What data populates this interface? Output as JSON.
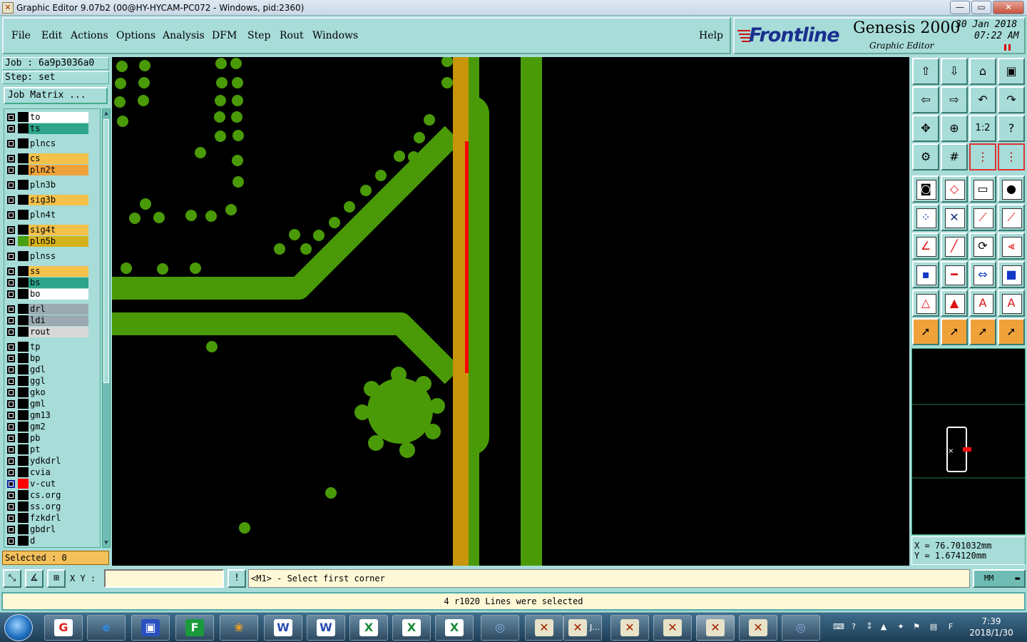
{
  "window": {
    "title": "Graphic Editor 9.07b2 (00@HY-HYCAM-PC072 - Windows, pid:2360)",
    "buttons": [
      "—",
      "▭",
      "✕"
    ]
  },
  "menu": {
    "items": [
      "File",
      "Edit",
      "Actions",
      "Options",
      "Analysis",
      "DFM",
      "Step",
      "Rout",
      "Windows"
    ],
    "help": "Help"
  },
  "logo": {
    "brand": "Frontline",
    "product": "Genesis 2000",
    "subtitle": "Graphic Editor",
    "date": "30 Jan 2018",
    "time": "07:22 AM"
  },
  "job": {
    "job_label": "Job : 6a9p3036a0",
    "step_label": "Step: set",
    "matrix_button": "Job Matrix ..."
  },
  "layers": [
    {
      "name": "to",
      "bg": "#ffffff",
      "color": "#000000"
    },
    {
      "name": "ts",
      "bg": "#2ea58a",
      "color": "#000000"
    },
    {
      "name": "plncs",
      "bg": "#a7dcd8",
      "color": "#000000"
    },
    {
      "name": "cs",
      "bg": "#f4c14a",
      "color": "#000000"
    },
    {
      "name": "pln2t",
      "bg": "#f0a23a",
      "color": "#000000"
    },
    {
      "name": "pln3b",
      "bg": "#a7dcd8",
      "color": "#000000"
    },
    {
      "name": "sig3b",
      "bg": "#f4c14a",
      "color": "#000000"
    },
    {
      "name": "pln4t",
      "bg": "#a7dcd8",
      "color": "#000000"
    },
    {
      "name": "sig4t",
      "bg": "#f4c14a",
      "color": "#000000"
    },
    {
      "name": "pln5b",
      "bg": "#d4b21c",
      "color": "#4aa010"
    },
    {
      "name": "plnss",
      "bg": "#a7dcd8",
      "color": "#000000"
    },
    {
      "name": "ss",
      "bg": "#f4c14a",
      "color": "#000000"
    },
    {
      "name": "bs",
      "bg": "#2ea58a",
      "color": "#000000"
    },
    {
      "name": "bo",
      "bg": "#ffffff",
      "color": "#000000"
    },
    {
      "name": "drl",
      "bg": "#9aaab0",
      "color": "#000000"
    },
    {
      "name": "ldi",
      "bg": "#9aaab0",
      "color": "#000000"
    },
    {
      "name": "rout",
      "bg": "#d8d8d8",
      "color": "#000000"
    },
    {
      "name": "tp",
      "bg": "#a7dcd8",
      "color": "#000000"
    },
    {
      "name": "bp",
      "bg": "#a7dcd8",
      "color": "#000000"
    },
    {
      "name": "gdl",
      "bg": "#a7dcd8",
      "color": "#000000"
    },
    {
      "name": "ggl",
      "bg": "#a7dcd8",
      "color": "#000000"
    },
    {
      "name": "gko",
      "bg": "#a7dcd8",
      "color": "#000000"
    },
    {
      "name": "gml",
      "bg": "#a7dcd8",
      "color": "#000000"
    },
    {
      "name": "gm13",
      "bg": "#a7dcd8",
      "color": "#000000"
    },
    {
      "name": "gm2",
      "bg": "#a7dcd8",
      "color": "#000000"
    },
    {
      "name": "pb",
      "bg": "#a7dcd8",
      "color": "#000000"
    },
    {
      "name": "pt",
      "bg": "#a7dcd8",
      "color": "#000000"
    },
    {
      "name": "ydkdrl",
      "bg": "#a7dcd8",
      "color": "#000000"
    },
    {
      "name": "cvia",
      "bg": "#a7dcd8",
      "color": "#000000"
    },
    {
      "name": "v-cut",
      "bg": "#a7dcd8",
      "color": "#ff0000",
      "active": true
    },
    {
      "name": "cs.org",
      "bg": "#a7dcd8",
      "color": "#000000"
    },
    {
      "name": "ss.org",
      "bg": "#a7dcd8",
      "color": "#000000"
    },
    {
      "name": "fzkdrl",
      "bg": "#a7dcd8",
      "color": "#000000"
    },
    {
      "name": "gbdrl",
      "bg": "#a7dcd8",
      "color": "#000000"
    },
    {
      "name": "d",
      "bg": "#a7dcd8",
      "color": "#000000"
    }
  ],
  "selected": "Selected : 0",
  "coords": {
    "x_label": "X = 76.701032mm",
    "y_label": "Y = 1.674120mm"
  },
  "bottom": {
    "xy_label": "X Y :",
    "xy_value": "",
    "prompt_icon": "!",
    "prompt": "<M1> - Select first corner",
    "units": "MM",
    "status": "4 r1020 Lines were selected"
  },
  "toolbar": {
    "zoom_one_to_two": "1:2",
    "help_glyph": "?"
  },
  "taskbar": {
    "time": "7:39",
    "date": "2018/1/30",
    "item_label": "J..."
  },
  "colors": {
    "canvas_bg": "#000000",
    "copper_green": "#4a9a08",
    "trace_gold": "#c8940a",
    "vcut_red": "#ff0000",
    "panel_cyan": "#a7dcd8"
  }
}
